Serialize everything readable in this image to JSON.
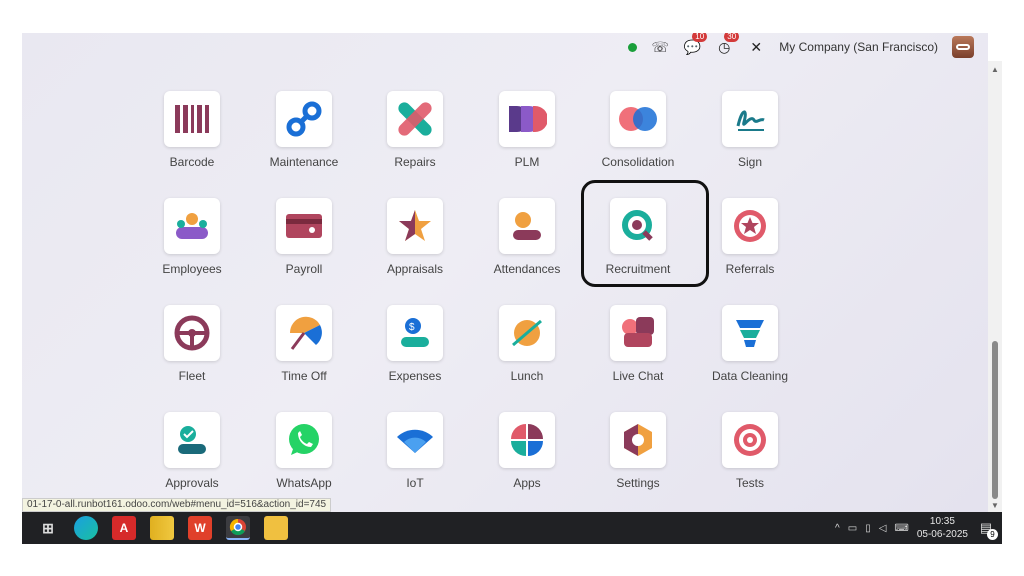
{
  "topbar": {
    "status_color": "#1a9f3a",
    "icons": [
      "phone-icon",
      "chat-icon",
      "activity-clock-icon",
      "tools-icon"
    ],
    "chat_badge": "10",
    "activity_badge": "30",
    "company": "My Company (San Francisco)"
  },
  "apps": [
    {
      "label": "Barcode",
      "icon": "barcode-icon"
    },
    {
      "label": "Maintenance",
      "icon": "maintenance-icon"
    },
    {
      "label": "Repairs",
      "icon": "repairs-icon"
    },
    {
      "label": "PLM",
      "icon": "plm-icon"
    },
    {
      "label": "Consolidation",
      "icon": "consolidation-icon"
    },
    {
      "label": "Sign",
      "icon": "sign-icon"
    },
    {
      "label": "Employees",
      "icon": "employees-icon"
    },
    {
      "label": "Payroll",
      "icon": "payroll-icon"
    },
    {
      "label": "Appraisals",
      "icon": "appraisals-icon"
    },
    {
      "label": "Attendances",
      "icon": "attendances-icon"
    },
    {
      "label": "Recruitment",
      "icon": "recruitment-icon"
    },
    {
      "label": "Referrals",
      "icon": "referrals-icon"
    },
    {
      "label": "Fleet",
      "icon": "fleet-icon"
    },
    {
      "label": "Time Off",
      "icon": "time-off-icon"
    },
    {
      "label": "Expenses",
      "icon": "expenses-icon"
    },
    {
      "label": "Lunch",
      "icon": "lunch-icon"
    },
    {
      "label": "Live Chat",
      "icon": "live-chat-icon"
    },
    {
      "label": "Data Cleaning",
      "icon": "data-cleaning-icon"
    },
    {
      "label": "Approvals",
      "icon": "approvals-icon"
    },
    {
      "label": "WhatsApp",
      "icon": "whatsapp-icon"
    },
    {
      "label": "IoT",
      "icon": "iot-icon"
    },
    {
      "label": "Apps",
      "icon": "apps-icon"
    },
    {
      "label": "Settings",
      "icon": "settings-icon"
    },
    {
      "label": "Tests",
      "icon": "tests-icon"
    }
  ],
  "url_status": "01-17-0-all.runbot161.odoo.com/web#menu_id=516&action_id=745",
  "taskbar": {
    "icons": [
      "task-view-icon",
      "edge-icon",
      "acrobat-icon",
      "power-bi-icon",
      "wps-icon",
      "chrome-icon",
      "file-explorer-icon"
    ],
    "time": "10:35",
    "date": "05-06-2025",
    "notification_count": "9"
  }
}
